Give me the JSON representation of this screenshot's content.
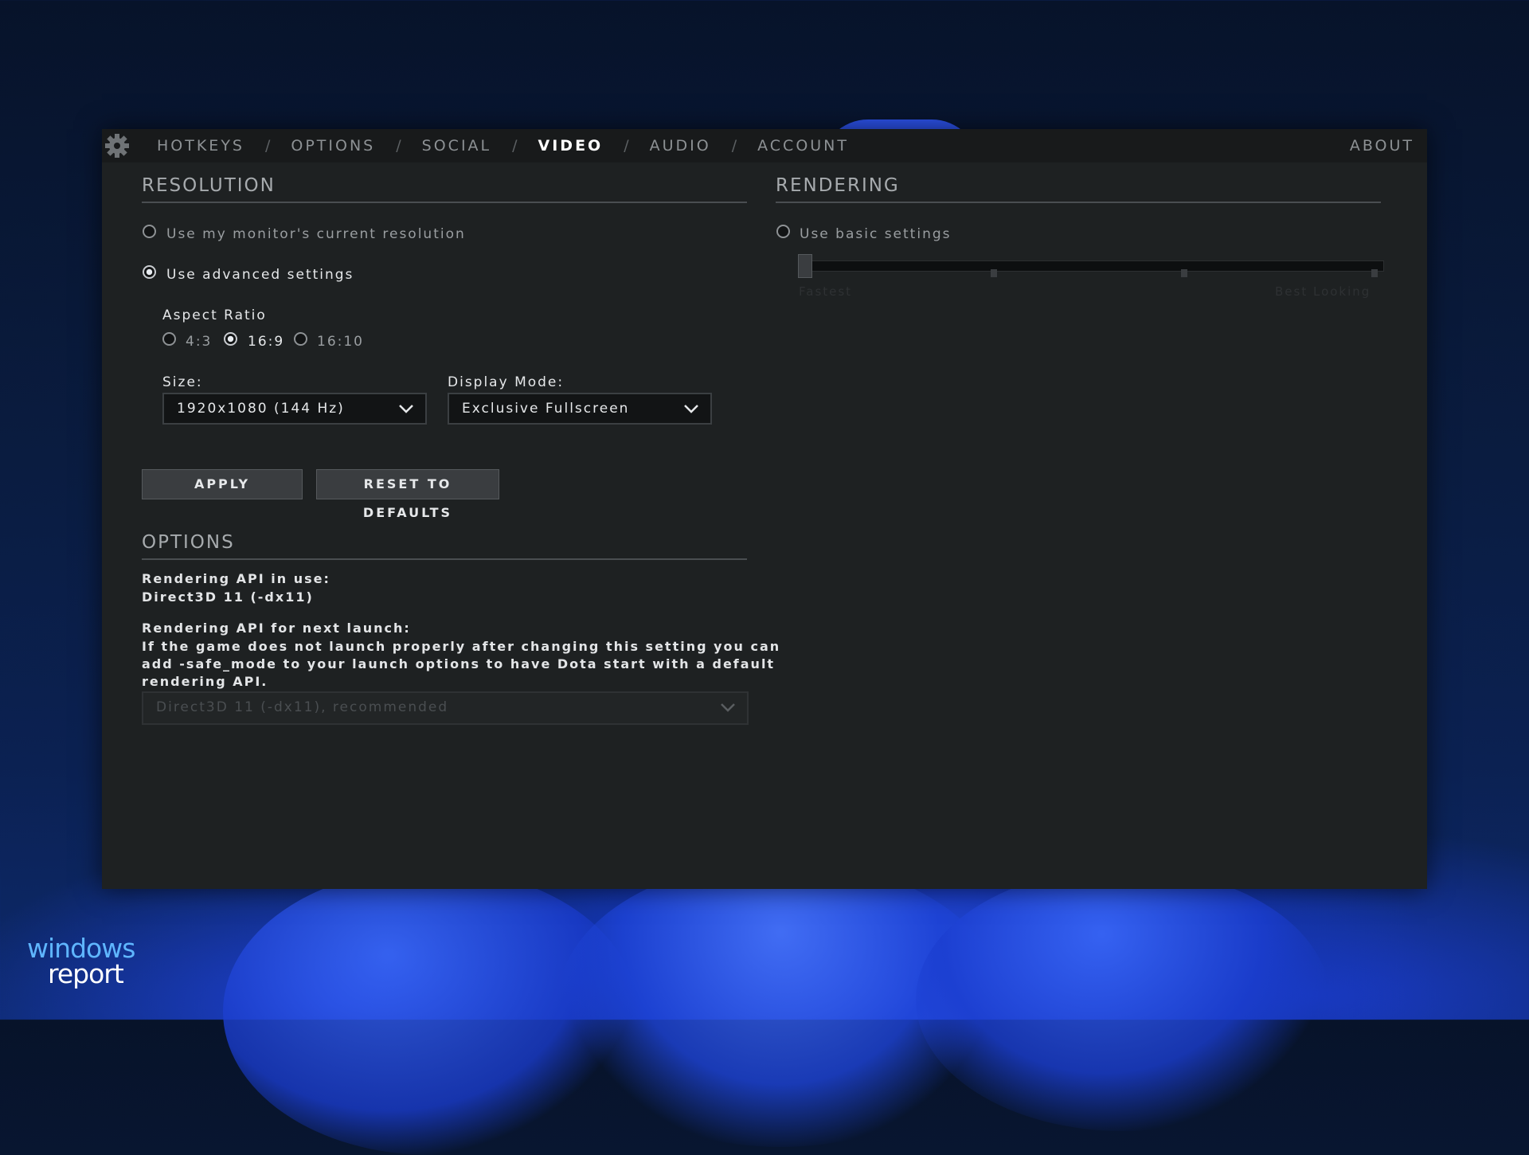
{
  "nav": {
    "tabs": [
      {
        "label": "HOTKEYS",
        "active": false
      },
      {
        "label": "OPTIONS",
        "active": false
      },
      {
        "label": "SOCIAL",
        "active": false
      },
      {
        "label": "VIDEO",
        "active": true
      },
      {
        "label": "AUDIO",
        "active": false
      },
      {
        "label": "ACCOUNT",
        "active": false
      }
    ],
    "separator": "/",
    "about": "ABOUT"
  },
  "resolution": {
    "title": "RESOLUTION",
    "option_current": "Use my monitor's current resolution",
    "option_advanced": "Use advanced settings",
    "selected_option": "advanced",
    "aspect_ratio_label": "Aspect Ratio",
    "aspect_ratios": [
      {
        "label": "4:3",
        "selected": false
      },
      {
        "label": "16:9",
        "selected": true
      },
      {
        "label": "16:10",
        "selected": false
      }
    ],
    "size_label": "Size:",
    "size_value": "1920x1080 (144 Hz)",
    "display_mode_label": "Display Mode:",
    "display_mode_value": "Exclusive Fullscreen",
    "apply": "APPLY",
    "reset": "RESET TO DEFAULTS"
  },
  "options": {
    "title": "OPTIONS",
    "api_in_use_label": "Rendering API in use:",
    "api_in_use_value": "Direct3D 11 (-dx11)",
    "api_next_label": "Rendering API for next launch:",
    "api_next_note_1": "If the game does not launch properly after changing this setting you can",
    "api_next_note_2": "add -safe_mode to your launch options to have Dota start with a default",
    "api_next_note_3": "rendering API.",
    "api_next_value": "Direct3D 11 (-dx11), recommended"
  },
  "rendering": {
    "title": "RENDERING",
    "option_basic": "Use basic settings",
    "option_basic_selected": false,
    "slider_min_label": "Fastest",
    "slider_max_label": "Best Looking",
    "slider_level": 0
  },
  "watermark": {
    "line1": "windows",
    "line2": "report"
  },
  "colors": {
    "background": "#1e2122",
    "navbar": "#181a1b",
    "accent_blue": "#2c52ea"
  }
}
